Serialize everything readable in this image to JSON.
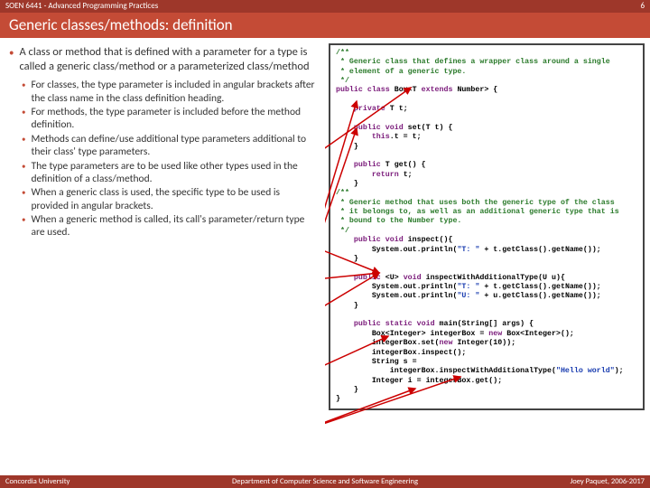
{
  "header": {
    "course": "SOEN 6441 - Advanced Programming Practices",
    "page_number": "6",
    "title": "Generic classes/methods: definition"
  },
  "main_bullet": "A class or method that is defined with a parameter for a type is called a generic class/method or a parameterized class/method",
  "sub_bullets": [
    "For classes, the type parameter is included in angular brackets after the class name in the class definition heading.",
    "For methods, the type parameter is included before the method definition.",
    "Methods can define/use additional type parameters additional to their class' type parameters.",
    "The type parameters are to be used like other types used in the definition of a class/method.",
    "When a generic class is used, the specific type to be used is provided in angular brackets.",
    "When a generic method is called, its call's parameter/return type are used."
  ],
  "code": {
    "l01": "/**",
    "l02": " * Generic class that defines a wrapper class around a single",
    "l03": " * element of a generic type.",
    "l04": " */",
    "l05a": "public",
    "l05b": " class",
    "l05c": " Box<T ",
    "l05d": "extends",
    "l05e": " Number> {",
    "l06": "",
    "l07a": "    private",
    "l07b": " T t;",
    "l08": "",
    "l09a": "    public",
    "l09b": " void",
    "l09c": " set(T t) {",
    "l10a": "        this",
    "l10b": ".t = t;",
    "l11": "    }",
    "l12": "",
    "l13a": "    public",
    "l13b": " T get() {",
    "l14a": "        return",
    "l14b": " t;",
    "l15": "    }",
    "l16": "/**",
    "l17": " * Generic method that uses both the generic type of the class",
    "l18": " * it belongs to, as well as an additional generic type that is",
    "l19": " * bound to the Number type.",
    "l20": " */",
    "l21a": "    public",
    "l21b": " void",
    "l21c": " inspect(){",
    "l22a": "        System.out.println(",
    "l22b": "\"T: \"",
    "l22c": " + t.getClass().getName());",
    "l23": "    }",
    "l24": "",
    "l25a": "    public",
    "l25b": " <U> ",
    "l25c": "void",
    "l25d": " inspectWithAdditionalType(U u){",
    "l26a": "        System.out.println(",
    "l26b": "\"T: \"",
    "l26c": " + t.getClass().getName());",
    "l27a": "        System.out.println(",
    "l27b": "\"U: \"",
    "l27c": " + u.getClass().getName());",
    "l28": "    }",
    "l29": "",
    "l30a": "    public",
    "l30b": " static",
    "l30c": " void",
    "l30d": " main(String[] args) {",
    "l31a": "        Box<Integer> integerBox = ",
    "l31b": "new",
    "l31c": " Box<Integer>();",
    "l32a": "        integerBox.set(",
    "l32b": "new",
    "l32c": " Integer(10));",
    "l33": "        integerBox.inspect();",
    "l34": "        String s =",
    "l35a": "            integerBox.inspectWithAdditionalType(",
    "l35b": "\"Hello world\"",
    "l35c": ");",
    "l36": "        Integer i = integerBox.get();",
    "l37": "    }",
    "l38": "}"
  },
  "footer": {
    "left": "Concordia University",
    "mid": "Department of Computer Science and Software Engineering",
    "right": "Joey Paquet, 2006-2017"
  }
}
